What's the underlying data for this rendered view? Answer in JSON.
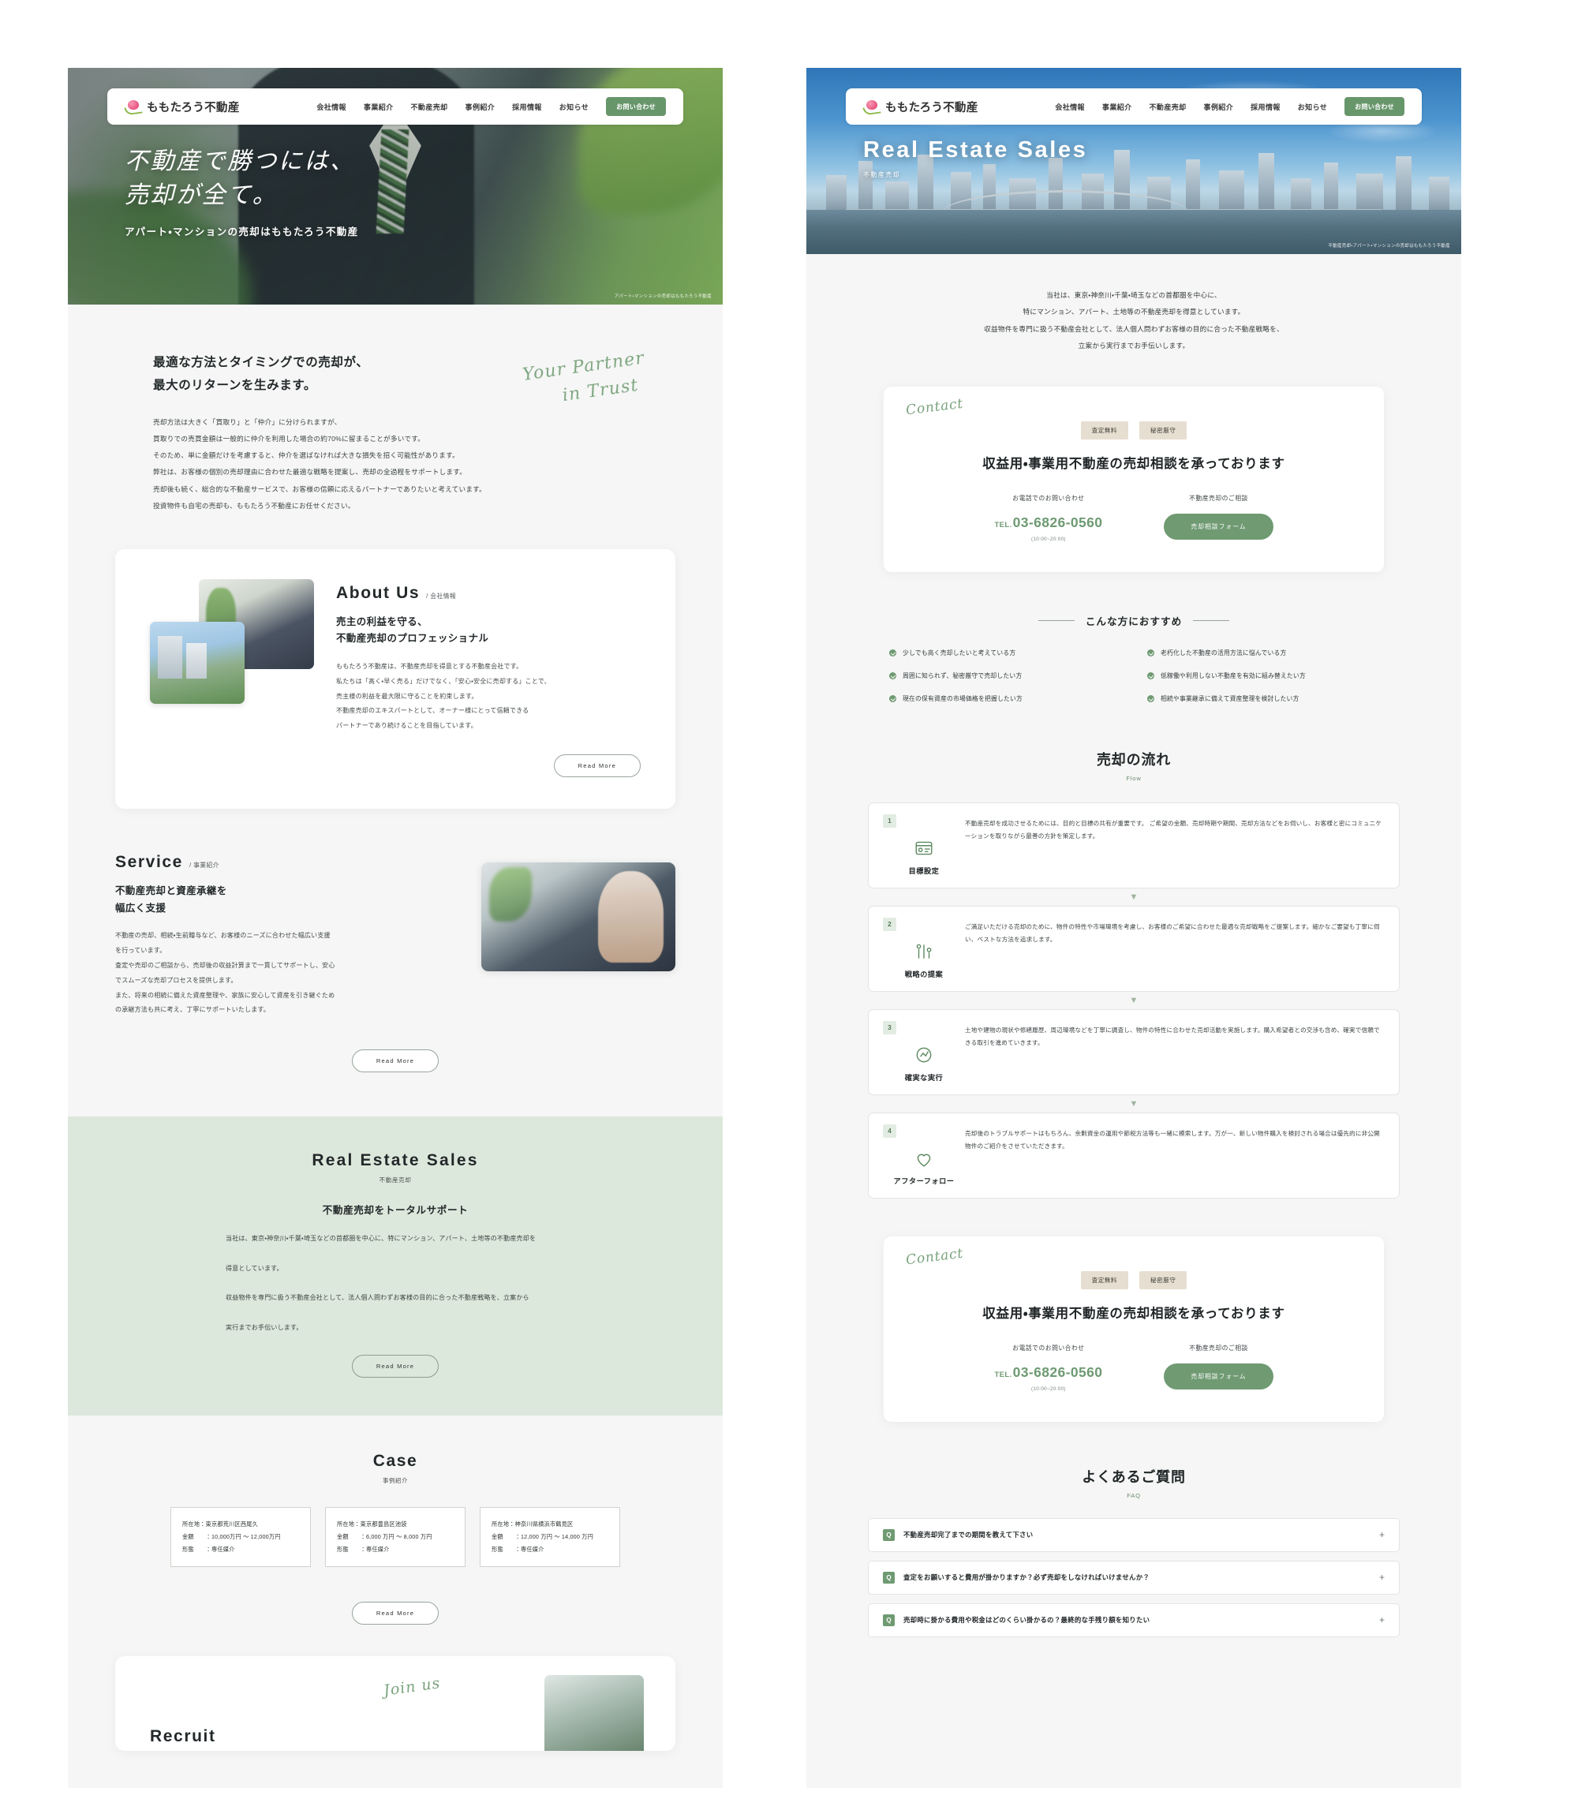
{
  "brand": {
    "name": "ももたろう不動産",
    "logo_icon": "peach-icon"
  },
  "nav": {
    "items": [
      "会社情報",
      "事業紹介",
      "不動産売却",
      "事例紹介",
      "採用情報",
      "お知らせ"
    ],
    "cta": "お問い合わせ"
  },
  "home": {
    "hero": {
      "headline_line1": "不動産で勝つには、",
      "headline_line2": "売却が全て。",
      "sub": "アパート・マンションの売却はももたろう不動産",
      "credit": "アパート・マンションの売却はももたろう不動産"
    },
    "intro": {
      "heading_line1": "最適な方法とタイミングでの売却が、",
      "heading_line2": "最大のリターンを生みます。",
      "script_line1": "Your Partner",
      "script_line2": "in Trust",
      "paragraphs": [
        "売却方法は大きく「買取り」と「仲介」に分けられますが、",
        "買取りでの売買金額は一般的に仲介を利用した場合の約70%に留まることが多いです。",
        "そのため、単に金額だけを考慮すると、仲介を選ばなければ大きな損失を招く可能性があります。",
        "弊社は、お客様の個別の売却理由に合わせた最適な戦略を提案し、売却の全過程をサポートします。",
        "売却後も続く、総合的な不動産サービスで、お客様の信頼に応えるパートナーでありたいと考えています。",
        "投資物件も自宅の売却も、ももたろう不動産にお任せください。"
      ]
    },
    "about": {
      "en": "About Us",
      "jp": "/ 会社情報",
      "h3_line1": "売主の利益を守る、",
      "h3_line2": "不動産売却のプロフェッショナル",
      "paragraphs": [
        "ももたろう不動産は、不動産売却を得意とする不動産会社です。",
        "私たちは「高く・早く売る」だけでなく、「安心・安全に売却する」ことで、",
        "売主様の利益を最大限に守ることを約束します。",
        "不動産売却のエキスパートとして、オーナー様にとって信頼できる",
        "パートナーであり続けることを目指しています。"
      ],
      "button": "Read More"
    },
    "service": {
      "en": "Service",
      "jp": "/ 事業紹介",
      "h3_line1": "不動産売却と資産承継を",
      "h3_line2": "幅広く支援",
      "paragraphs": [
        "不動産の売却、相続・生前贈与など、お客様のニーズに合わせた幅広い支援",
        "を行っています。",
        "査定や売却のご相談から、売却後の収益計算まで一貫してサポートし、安心",
        "でスムーズな売却プロセスを提供します。",
        "また、将来の相続に備えた資産整理や、家族に安心して資産を引き継ぐため",
        "の承継方法も共に考え、丁寧にサポートいたします。"
      ],
      "button": "Read More"
    },
    "sales_band": {
      "en": "Real Estate Sales",
      "jp": "不動産売却",
      "h3": "不動産売却をトータルサポート",
      "paragraphs": [
        "当社は、東京・神奈川・千葉・埼玉などの首都圏を中心に、特にマンション、アパート、土地等の不動産売却を",
        "得意としています。",
        "収益物件を専門に扱う不動産会社として、法人個人問わずお客様の目的に合った不動産戦略を、立案から",
        "実行までお手伝いします。"
      ],
      "button": "Read More"
    },
    "case": {
      "en": "Case",
      "jp": "事例紹介",
      "cards": [
        {
          "location": "所在地：東京都荒川区西尾久",
          "price": "金額　　：10,000万円 〜 12,000万円",
          "type": "形態　　：専任媒介"
        },
        {
          "location": "所在地：東京都豊島区池袋",
          "price": "金額　　：6,000 万円 〜 8,000 万円",
          "type": "形態　　：専任媒介"
        },
        {
          "location": "所在地：神奈川県横浜市鶴見区",
          "price": "金額　　：12,000 万円 〜 14,000 万円",
          "type": "形態　　：専任媒介"
        }
      ],
      "button": "Read More"
    },
    "recruit": {
      "en": "Recruit",
      "script": "Join us"
    }
  },
  "sales_page": {
    "hero": {
      "title": "Real Estate Sales",
      "sub": "不動産売却",
      "credit": "不動産売却・アパート・マンションの売却はももたろう不動産"
    },
    "lead": [
      "当社は、東京・神奈川・千葉・埼玉などの首都圏を中心に、",
      "特にマンション、アパート、土地等の不動産売却を得意としています。",
      "収益物件を専門に扱う不動産会社として、法人個人問わずお客様の目的に合った不動産戦略を、",
      "立案から実行までお手伝いします。"
    ],
    "contact": {
      "script": "Contact",
      "tags": [
        "査定無料",
        "秘密厳守"
      ],
      "heading": "収益用・事業用不動産の売却相談を承っております",
      "tel_label": "お電話でのお問い合わせ",
      "tel_prefix": "TEL.",
      "tel_number": "03-6826-0560",
      "tel_hours": "(10:00~20:00)",
      "form_label": "不動産売却のご相談",
      "form_button": "売却相談フォーム"
    },
    "recommend": {
      "heading": "こんな方におすすめ",
      "items": [
        "少しでも高く売却したいと考えている方",
        "老朽化した不動産の活用方法に悩んでいる方",
        "周囲に知られず、秘密厳守で売却したい方",
        "低稼働や利用しない不動産を有効に組み替えたい方",
        "現在の保有資産の市場価格を把握したい方",
        "相続や事業継承に備えて資産整理を検討したい方"
      ]
    },
    "flow": {
      "title": "売却の流れ",
      "subtitle": "Flow",
      "steps": [
        {
          "num": "1",
          "icon": "target-icon",
          "title": "目標設定",
          "body": "不動産売却を成功させるためには、目的と目標の共有が重要です。\nご希望の金額、売却時期や期間、売却方法などをお伺いし、お客様と密にコミュニケーションを取りながら最善の方針を策定します。"
        },
        {
          "num": "2",
          "icon": "strategy-icon",
          "title": "戦略の提案",
          "body": "ご満足いただける売却のために、物件の特性や市場環境を考慮し、お客様のご希望に合わせた最適な売却戦略をご提案します。細かなご要望も丁寧に伺い、ベストな方法を追求します。"
        },
        {
          "num": "3",
          "icon": "execute-icon",
          "title": "確実な実行",
          "body": "土地や建物の現状や修繕履歴、周辺環境などを丁寧に調査し、物件の特性に合わせた売却活動を実施します。購入希望者との交渉も含め、確実で信頼できる取引を進めていきます。"
        },
        {
          "num": "4",
          "icon": "followup-icon",
          "title": "アフターフォロー",
          "body": "売却後のトラブルサポートはもちろん、余剰資金の運用や節税方法等も一緒に模索します。万が一、新しい物件購入を検討される場合は優先的に非公開物件のご紹介をさせていただきます。"
        }
      ]
    },
    "faq": {
      "title": "よくあるご質問",
      "subtitle": "FAQ",
      "badge": "Q",
      "toggle": "+",
      "items": [
        "不動産売却完了までの期間を教えて下さい",
        "査定をお願いすると費用が掛かりますか？必ず売却をしなければいけませんか？",
        "売却時に掛かる費用や税金はどのくらい掛かるの？最終的な手残り額を知りたい"
      ]
    }
  },
  "colors": {
    "accent_green": "#6f9a72",
    "band_green": "#dde8dc",
    "tag_beige": "#e6ded0",
    "page_bg": "#f5f6f5"
  }
}
